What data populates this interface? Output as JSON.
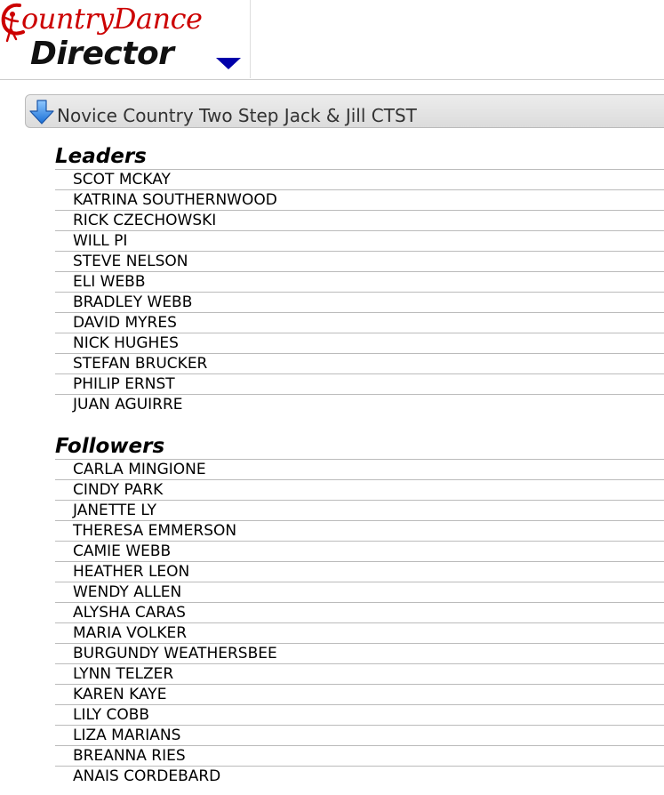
{
  "header": {
    "logo_line1": "ountryDance",
    "logo_line2": "Director",
    "menu_icon": "chevron-down-icon",
    "menu_color": "#0000aa"
  },
  "event": {
    "icon": "arrow-down-icon",
    "title": "Novice Country Two Step Jack & Jill CTST"
  },
  "leaders": {
    "heading": "Leaders",
    "names": [
      "SCOT MCKAY",
      "KATRINA SOUTHERNWOOD",
      "RICK CZECHOWSKI",
      "WILL PI",
      "STEVE NELSON",
      "ELI WEBB",
      "BRADLEY WEBB",
      "DAVID MYRES",
      "NICK HUGHES",
      "STEFAN BRUCKER",
      "PHILIP ERNST",
      "JUAN AGUIRRE"
    ]
  },
  "followers": {
    "heading": "Followers",
    "names": [
      "CARLA MINGIONE",
      "CINDY PARK",
      "JANETTE LY",
      "THERESA EMMERSON",
      "CAMIE WEBB",
      "HEATHER LEON",
      "WENDY ALLEN",
      "ALYSHA CARAS",
      "MARIA VOLKER",
      "BURGUNDY WEATHERSBEE",
      "LYNN TELZER",
      "KAREN KAYE",
      "LILY COBB",
      "LIZA MARIANS",
      "BREANNA RIES",
      "ANAIS CORDEBARD"
    ]
  }
}
